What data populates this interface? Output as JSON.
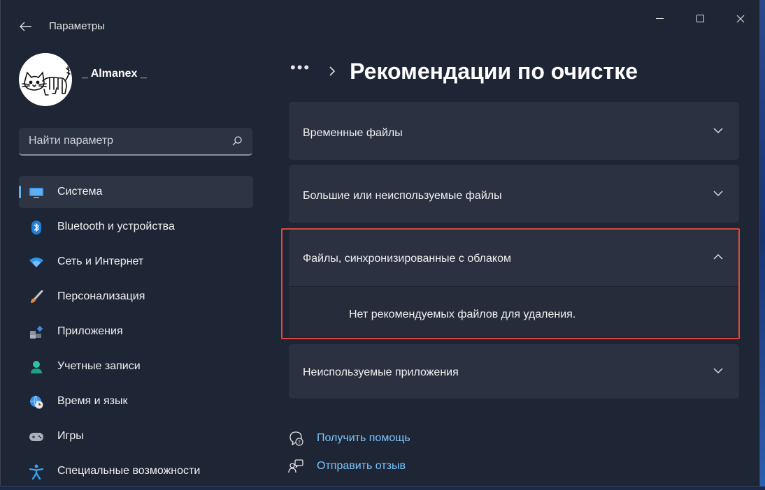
{
  "window": {
    "title": "Параметры",
    "controls": {
      "minimize": "—",
      "maximize": "☐",
      "close": "✕"
    }
  },
  "user": {
    "name": "_ Almanex _",
    "avatar_icon": "cat-drawing-avatar"
  },
  "search": {
    "placeholder": "Найти параметр",
    "icon": "search-icon"
  },
  "sidebar": {
    "items": [
      {
        "label": "Система",
        "icon": "system-display-icon",
        "active": true
      },
      {
        "label": "Bluetooth и устройства",
        "icon": "bluetooth-icon"
      },
      {
        "label": "Сеть и Интернет",
        "icon": "wifi-icon"
      },
      {
        "label": "Персонализация",
        "icon": "brush-icon"
      },
      {
        "label": "Приложения",
        "icon": "apps-icon"
      },
      {
        "label": "Учетные записи",
        "icon": "person-icon"
      },
      {
        "label": "Время и язык",
        "icon": "globe-clock-icon"
      },
      {
        "label": "Игры",
        "icon": "gamepad-icon"
      },
      {
        "label": "Специальные возможности",
        "icon": "accessibility-icon"
      }
    ]
  },
  "header": {
    "breadcrumb_overflow": "•••",
    "title": "Рекомендации по очистке"
  },
  "sections": [
    {
      "label": "Временные файлы",
      "expanded": false
    },
    {
      "label": "Большие или неиспользуемые файлы",
      "expanded": false
    },
    {
      "label": "Файлы, синхронизированные с облаком",
      "expanded": true,
      "body": "Нет рекомендуемых файлов для удаления."
    },
    {
      "label": "Неиспользуемые приложения",
      "expanded": false
    }
  ],
  "footer_links": [
    {
      "label": "Получить помощь",
      "icon": "help-chat-icon"
    },
    {
      "label": "Отправить отзыв",
      "icon": "feedback-icon"
    }
  ],
  "colors": {
    "accent": "#5fb2f2",
    "link": "#7cc6ff",
    "highlight": "#e0483e",
    "background": "#1e2534",
    "card": "#2b3140"
  }
}
